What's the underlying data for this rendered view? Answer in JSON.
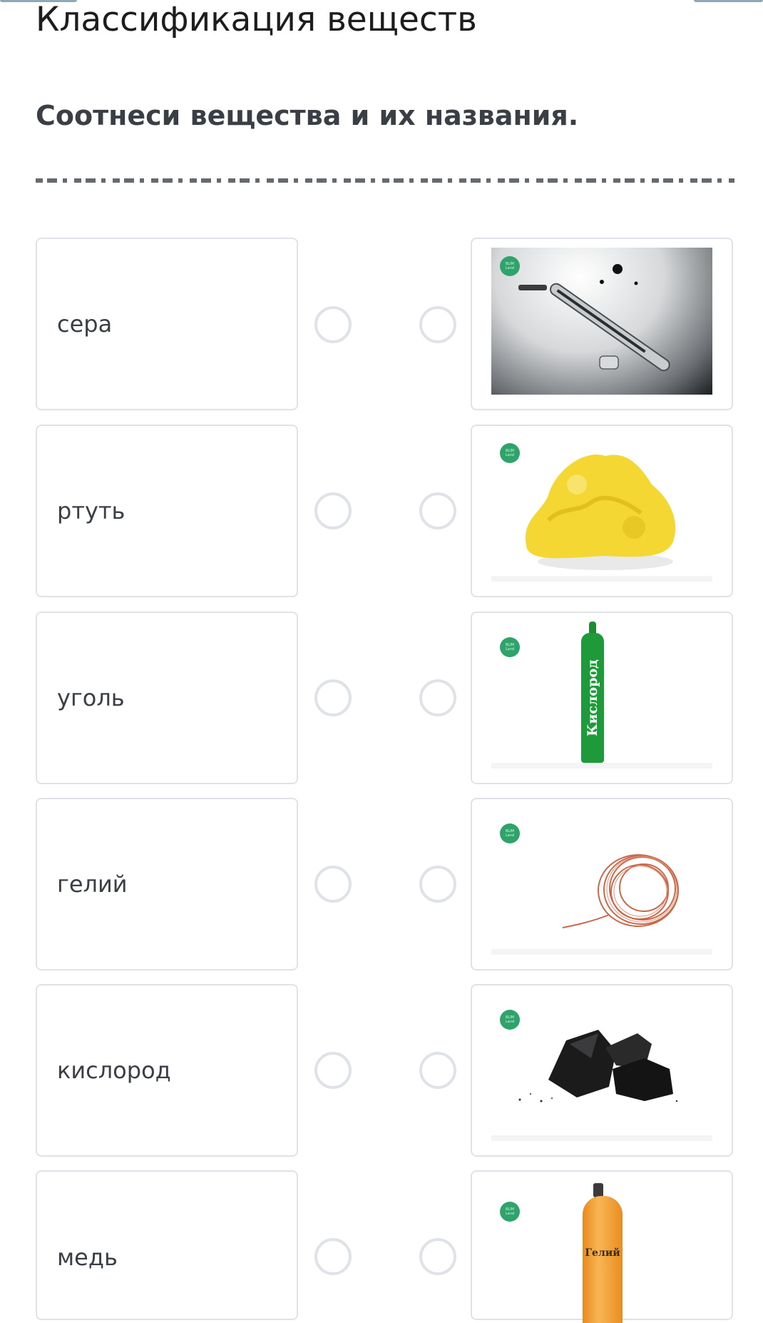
{
  "page_title": "Классификация веществ",
  "prompt": "Соотнеси вещества и их названия.",
  "left_items": [
    {
      "label": "сера"
    },
    {
      "label": "ртуть"
    },
    {
      "label": "уголь"
    },
    {
      "label": "гелий"
    },
    {
      "label": "кислород"
    },
    {
      "label": "медь"
    }
  ],
  "right_items": [
    {
      "image": "mercury-thermometer-image"
    },
    {
      "image": "sulfur-image"
    },
    {
      "image": "oxygen-cylinder-image",
      "caption": "Кислород"
    },
    {
      "image": "copper-wire-image"
    },
    {
      "image": "coal-image"
    },
    {
      "image": "helium-cylinder-image",
      "caption": "Гелий"
    }
  ],
  "badge_text": "BLIM Land",
  "colors": {
    "accent_green": "#2fa46a",
    "card_border": "#dfe3e7",
    "oxygen_cylinder": "#1f9a3a",
    "helium_cylinder": "#f2a33a"
  }
}
